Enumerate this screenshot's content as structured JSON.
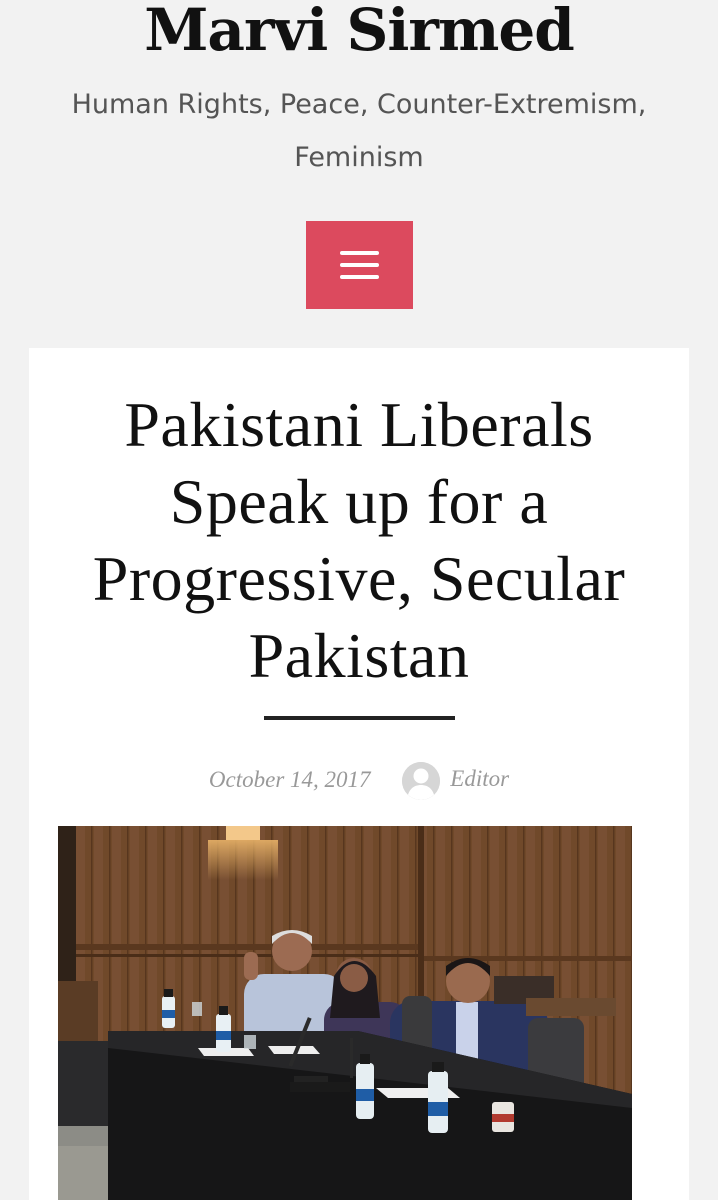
{
  "site": {
    "title": "Marvi Sirmed",
    "tagline": "Human Rights, Peace, Counter-Extremism, Feminism"
  },
  "menu": {
    "icon": "hamburger-menu-icon",
    "color": "#dc4a5e"
  },
  "post": {
    "title": "Pakistani Liberals Speak up for a Progressive, Secular Pakistan",
    "date": "October 14, 2017",
    "author": "Editor",
    "avatar_icon": "default-avatar-icon",
    "featured_image_icon": "panel-discussion-photo"
  },
  "colors": {
    "page_background": "#f2f2f2",
    "accent": "#dc4a5e",
    "title_text": "#111111",
    "meta_text": "#999999"
  }
}
